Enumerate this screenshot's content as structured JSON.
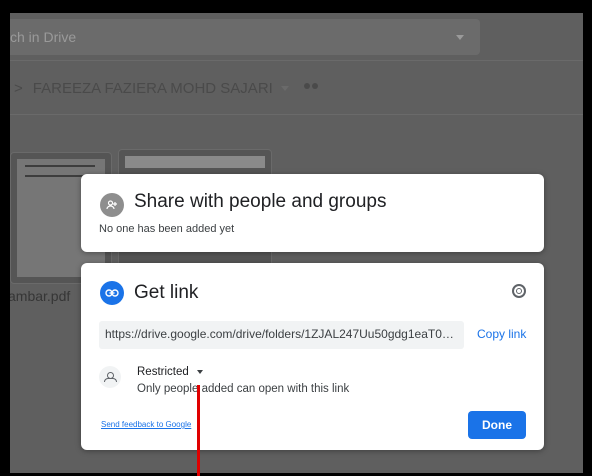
{
  "drive": {
    "search_placeholder": "ch in Drive",
    "breadcrumb_sep": ">",
    "folder_name": "FAREEZA FAZIERA MOHD SAJARI",
    "file_name": "ambar.pdf"
  },
  "share_dialog": {
    "title": "Share with people and groups",
    "subtitle": "No one has been added yet"
  },
  "link_dialog": {
    "title": "Get link",
    "url": "https://drive.google.com/drive/folders/1ZJAL247Uu50gdg1eaT0FhhQglvPA...",
    "copy_label": "Copy link",
    "access_label": "Restricted",
    "access_desc": "Only people added can open with this link",
    "feedback_label": "Send feedback to Google",
    "done_label": "Done"
  },
  "colors": {
    "accent": "#1a73e8",
    "annotation": "#e00000"
  }
}
